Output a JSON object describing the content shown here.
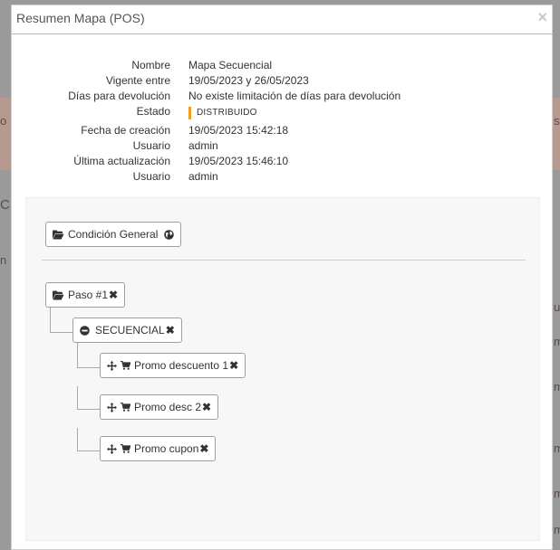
{
  "background": {
    "frag_left_1": "o",
    "frag_right_1": "s",
    "frag_left_2": "CI",
    "frag_left_3": "n",
    "frag_right_2": "u",
    "frag_right_3": "m"
  },
  "modal": {
    "title": "Resumen Mapa (POS)",
    "close": "×"
  },
  "info": {
    "nombre_label": "Nombre",
    "nombre_value": "Mapa Secuencial",
    "vigente_label": "Vigente entre",
    "vigente_value": "19/05/2023 y 26/05/2023",
    "dias_label": "Días para devolución",
    "dias_value": "No existe limitación de días para devolución",
    "estado_label": "Estado",
    "estado_value": "DISTRIBUIDO",
    "fecha_label": "Fecha de creación",
    "fecha_value": "19/05/2023 15:42:18",
    "usuario1_label": "Usuario",
    "usuario1_value": "admin",
    "ultima_label": "Última actualización",
    "ultima_value": "19/05/2023 15:46:10",
    "usuario2_label": "Usuario",
    "usuario2_value": "admin"
  },
  "tree": {
    "condicion": "Condición General",
    "paso": "Paso #1",
    "secuencial": "SECUENCIAL",
    "promo1": "Promo descuento 1",
    "promo2": "Promo desc 2",
    "promo3": "Promo cupon",
    "remove": "✖"
  },
  "colors": {
    "accent": "#f0ad4e",
    "status_bar": "#f0a020"
  }
}
